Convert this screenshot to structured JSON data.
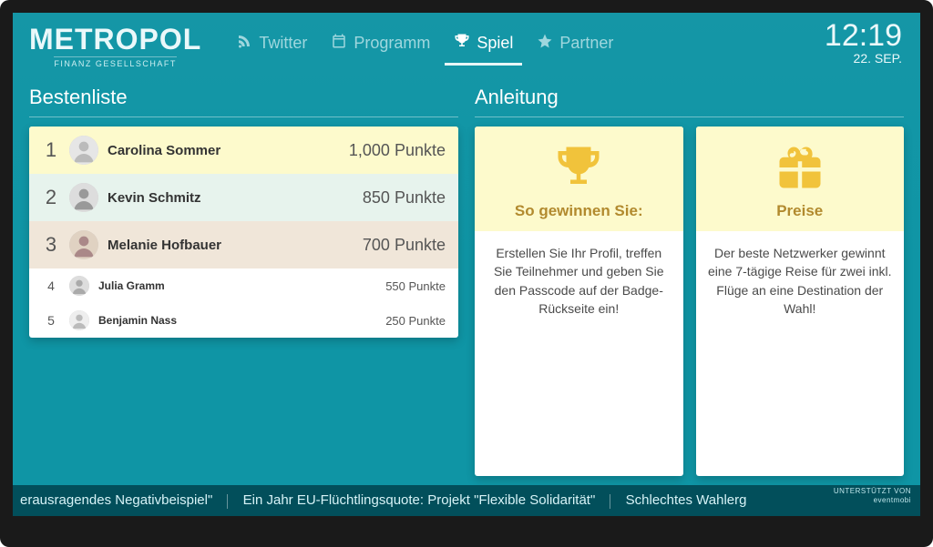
{
  "brand": {
    "name": "METROPOL",
    "sub": "FINANZ GESELLSCHAFT"
  },
  "nav": {
    "tabs": [
      {
        "label": "Twitter",
        "icon": "rss-icon",
        "active": false
      },
      {
        "label": "Programm",
        "icon": "calendar-icon",
        "active": false
      },
      {
        "label": "Spiel",
        "icon": "trophy-icon",
        "active": true
      },
      {
        "label": "Partner",
        "icon": "star-icon",
        "active": false
      }
    ]
  },
  "clock": {
    "time": "12:19",
    "date": "22. SEP."
  },
  "leaderboard": {
    "title": "Bestenliste",
    "points_suffix": "Punkte",
    "rows": [
      {
        "rank": "1",
        "name": "Carolina Sommer",
        "points": "1,000"
      },
      {
        "rank": "2",
        "name": "Kevin Schmitz",
        "points": "850"
      },
      {
        "rank": "3",
        "name": "Melanie Hofbauer",
        "points": "700"
      },
      {
        "rank": "4",
        "name": "Julia Gramm",
        "points": "550"
      },
      {
        "rank": "5",
        "name": "Benjamin Nass",
        "points": "250"
      }
    ]
  },
  "instructions": {
    "title": "Anleitung",
    "cards": [
      {
        "icon": "trophy-icon",
        "title": "So gewinnen Sie:",
        "body": "Erstellen Sie Ihr Profil, treffen Sie Teilnehmer und geben Sie den Passcode auf der Badge-Rückseite ein!"
      },
      {
        "icon": "gift-icon",
        "title": "Preise",
        "body": "Der beste Netzwerker gewinnt eine 7-tägige Reise für zwei inkl. Flüge an eine Destination der Wahl!"
      }
    ]
  },
  "ticker": {
    "items": [
      "erausragendes Negativbeispiel\"",
      "Ein Jahr EU-Flüchtlingsquote: Projekt \"Flexible Solidarität\"",
      "Schlechtes Wahlerg"
    ]
  },
  "sponsor": {
    "label": "UNTERSTÜTZT VON",
    "name": "eventmobi"
  }
}
